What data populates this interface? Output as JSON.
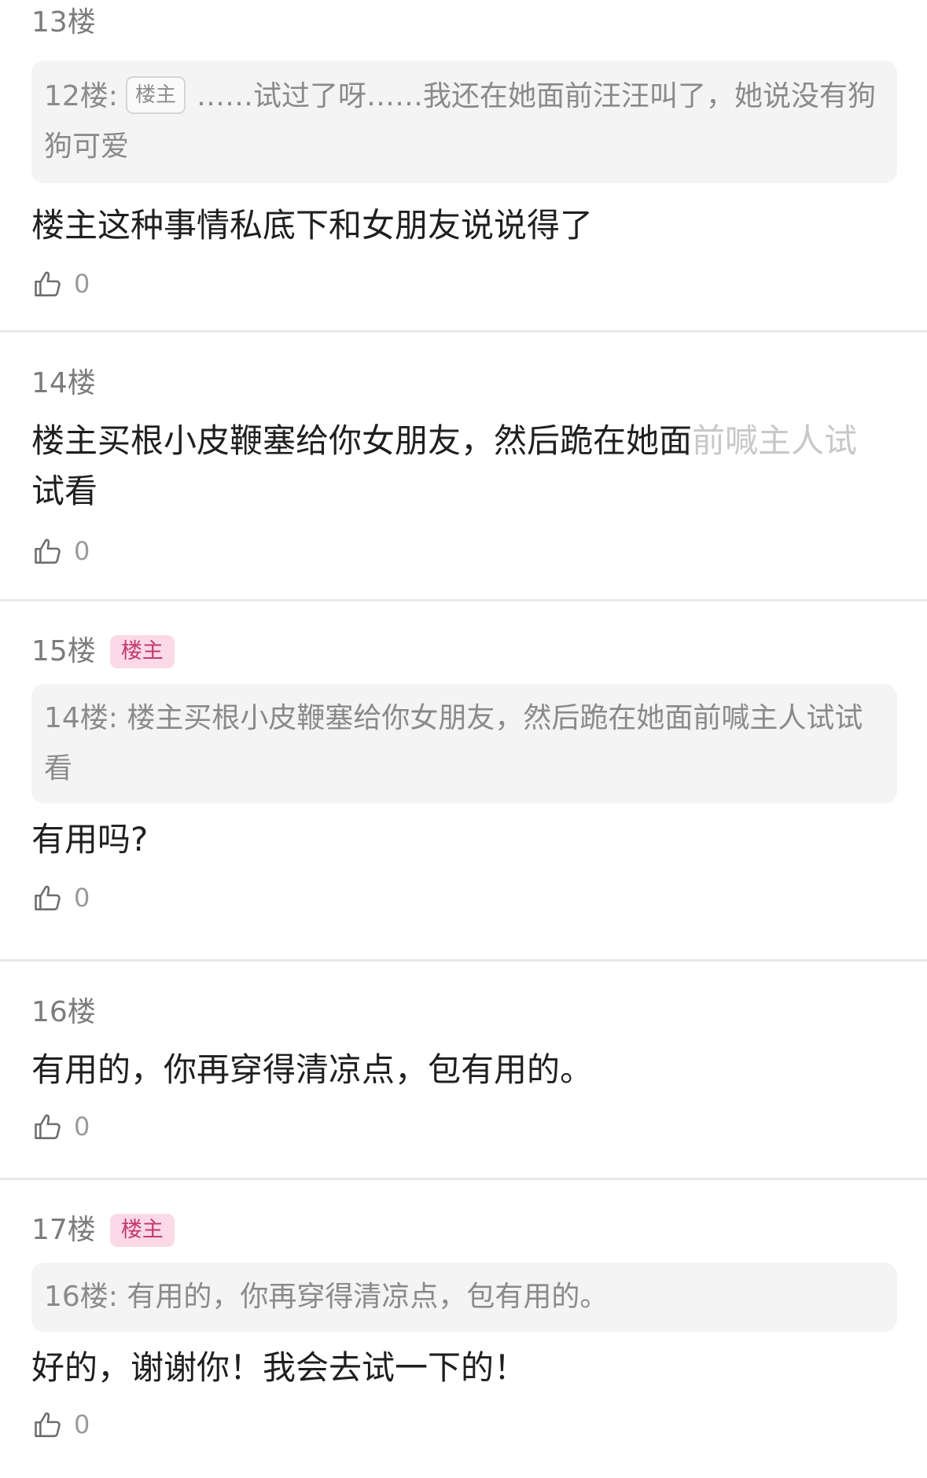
{
  "posts": [
    {
      "floor": "13楼",
      "quote": {
        "floor_ref": "12楼:",
        "badge": "楼主",
        "text": "……试过了呀……我还在她面前汪汪叫了，她说没有狗狗可爱"
      },
      "body": "楼主这种事情私底下和女朋友说说得了",
      "likes": "0"
    },
    {
      "floor": "14楼",
      "body_main": "楼主买根小皮鞭塞给你女朋友，然后跪在她面",
      "body_faded": "前喊主人试",
      "body_rest": "试看",
      "likes": "0"
    },
    {
      "floor": "15楼",
      "badge": "楼主",
      "quote": {
        "text": "14楼: 楼主买根小皮鞭塞给你女朋友，然后跪在她面前喊主人试试看"
      },
      "body": "有用吗?",
      "likes": "0"
    },
    {
      "floor": "16楼",
      "body": "有用的，你再穿得清凉点，包有用的。",
      "likes": "0"
    },
    {
      "floor": "17楼",
      "badge": "楼主",
      "quote": {
        "text": "16楼: 有用的，你再穿得清凉点，包有用的。"
      },
      "body": "好的，谢谢你！我会去试一下的！",
      "likes": "0"
    }
  ],
  "icons": {
    "like": "thumbs-up-outline-icon"
  },
  "colors": {
    "op_badge_bg": "#fbd9e6",
    "op_badge_text": "#c23a6e",
    "quote_bg": "#f4f4f5",
    "divider": "#e6e8ec"
  }
}
